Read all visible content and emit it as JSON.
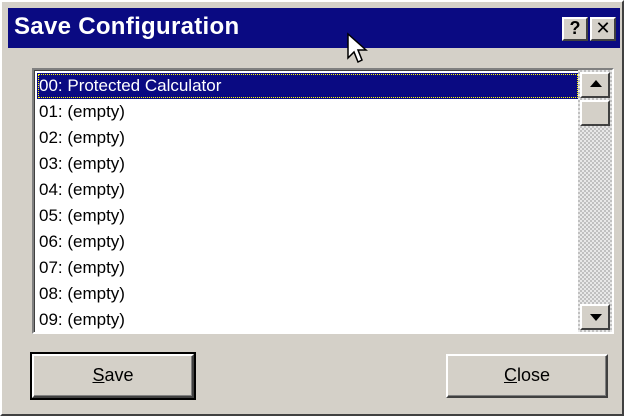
{
  "window": {
    "title": "Save Configuration",
    "help_icon": "question-mark-icon",
    "help_label": "?",
    "close_icon": "close-x-icon",
    "close_label": "✕"
  },
  "colors": {
    "titlebar_bg": "#0a0a82",
    "face": "#d4d0c8",
    "selection_bg": "#0a0a82"
  },
  "list": {
    "selected_index": 0,
    "items": [
      "00: Protected Calculator",
      "01: (empty)",
      "02: (empty)",
      "03: (empty)",
      "04: (empty)",
      "05: (empty)",
      "06: (empty)",
      "07: (empty)",
      "08: (empty)",
      "09: (empty)"
    ]
  },
  "buttons": {
    "save_label": "Save",
    "close_label": "Close"
  }
}
